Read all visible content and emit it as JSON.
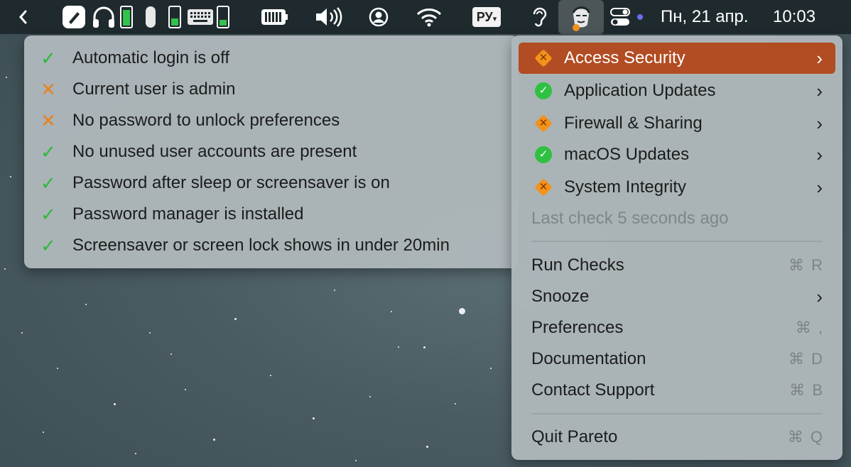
{
  "menubar": {
    "date": "Пн, 21 апр.",
    "time": "10:03",
    "language": "РУ",
    "icons": [
      "chevron-left-icon",
      "bluetooth-tag-icon",
      "headphones-icon",
      "battery-icon",
      "mouse-icon",
      "battery-icon",
      "keyboard-icon",
      "battery-icon",
      "battery-case-icon",
      "volume-icon",
      "user-account-icon",
      "wifi-icon",
      "language-icon",
      "ear-icon",
      "pareto-app-icon",
      "control-center-icon",
      "dot-indicator-icon"
    ]
  },
  "submenu": {
    "items": [
      {
        "status": "ok",
        "mark": "✓",
        "label": "Automatic login is off"
      },
      {
        "status": "bad",
        "mark": "✕",
        "label": "Current user is admin"
      },
      {
        "status": "bad",
        "mark": "✕",
        "label": "No password to unlock preferences"
      },
      {
        "status": "ok",
        "mark": "✓",
        "label": "No unused user accounts are present"
      },
      {
        "status": "ok",
        "mark": "✓",
        "label": "Password after sleep or screensaver is on"
      },
      {
        "status": "ok",
        "mark": "✓",
        "label": "Password manager is installed"
      },
      {
        "status": "ok",
        "mark": "✓",
        "label": "Screensaver or screen lock shows in under 20min"
      }
    ]
  },
  "mainmenu": {
    "categories": [
      {
        "label": "Access Security",
        "status": "warning",
        "chevron": "›"
      },
      {
        "label": "Application Updates",
        "status": "ok",
        "chevron": "›"
      },
      {
        "label": "Firewall & Sharing",
        "status": "warning",
        "chevron": "›"
      },
      {
        "label": "macOS Updates",
        "status": "ok",
        "chevron": "›"
      },
      {
        "label": "System Integrity",
        "status": "warning",
        "chevron": "›"
      }
    ],
    "last_check": "Last check 5 seconds ago",
    "actions": [
      {
        "label": "Run Checks",
        "shortcut": "⌘ R"
      },
      {
        "label": "Snooze",
        "chevron": "›"
      },
      {
        "label": "Preferences",
        "shortcut": "⌘ ,"
      },
      {
        "label": "Documentation",
        "shortcut": "⌘ D"
      },
      {
        "label": "Contact Support",
        "shortcut": "⌘ B"
      }
    ],
    "quit": {
      "label": "Quit Pareto",
      "shortcut": "⌘ Q"
    }
  },
  "colors": {
    "selected": "#b24c22",
    "warning": "#f3921c",
    "ok": "#2fc143",
    "menu_bg": "#adb7ba",
    "menubar_bg": "#1f2a2e"
  }
}
